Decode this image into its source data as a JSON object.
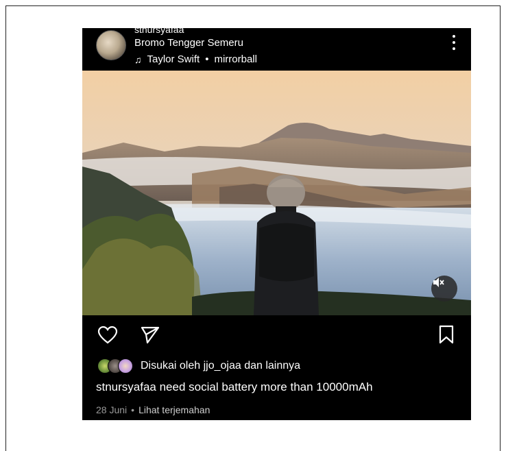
{
  "post": {
    "username": "stnursyafaa",
    "location": "Bromo Tengger Semeru",
    "music": {
      "artist": "Taylor Swift",
      "separator": "•",
      "song": "mirrorball"
    },
    "likes_text": "Disukai oleh jjo_ojaa dan lainnya",
    "caption": "stnursyafaa need social battery more than 10000mAh",
    "date": "28 Juni",
    "dot": "•",
    "translate_link": "Lihat terjemahan"
  },
  "icons": {
    "more": "more-vertical-icon",
    "music": "music-note-icon",
    "mute": "volume-off-icon",
    "like": "heart-icon",
    "share": "send-icon",
    "save": "bookmark-icon"
  }
}
